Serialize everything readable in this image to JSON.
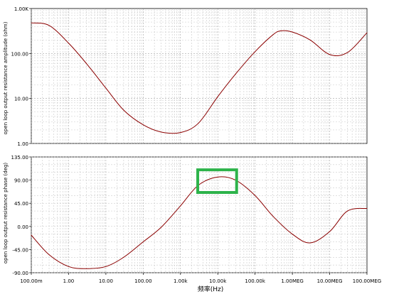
{
  "chart_data": [
    {
      "type": "line",
      "x_scale": "log",
      "y_scale": "log",
      "xlim": [
        0.1,
        100000000
      ],
      "ylim": [
        1,
        1000
      ],
      "y_ticks": [
        1,
        10,
        100,
        1000
      ],
      "y_tick_labels": [
        "1.00",
        "10.00",
        "100.00",
        "1.00K"
      ],
      "ylabel": "open loop output resistance amplitude (ohm)",
      "grid": true,
      "series": [
        {
          "color": "#8b0000",
          "x": [
            0.1,
            0.3,
            1,
            3,
            10,
            30,
            100,
            300,
            1000,
            3000,
            10000,
            30000,
            100000,
            300000,
            500000,
            1000000,
            3000000,
            10000000,
            30000000,
            100000000
          ],
          "y": [
            480,
            420,
            170,
            60,
            17,
            5.5,
            2.6,
            1.8,
            1.75,
            2.8,
            11,
            35,
            110,
            260,
            320,
            300,
            200,
            95,
            105,
            290
          ]
        }
      ]
    },
    {
      "type": "line",
      "x_scale": "log",
      "xlim": [
        0.1,
        100000000
      ],
      "ylim": [
        -90,
        135
      ],
      "y_ticks": [
        -90,
        -45,
        0,
        45,
        90,
        135
      ],
      "y_tick_labels": [
        "-90.00",
        "-45.00",
        "0.00",
        "45.00",
        "90.00",
        "135.00"
      ],
      "ylabel": "open loop output resistance phase (deg)",
      "x_ticks": [
        0.1,
        1,
        10,
        100,
        1000,
        10000,
        100000,
        1000000,
        10000000,
        100000000
      ],
      "x_tick_labels": [
        "100.00m",
        "1.00",
        "10.00",
        "100.00",
        "1.00k",
        "10.00k",
        "100.00k",
        "1.00MEG",
        "10.00MEG",
        "100.00MEG"
      ],
      "xlabel": "频率(Hz)",
      "grid": true,
      "series": [
        {
          "color": "#8b0000",
          "x": [
            0.1,
            0.3,
            1,
            3,
            10,
            30,
            100,
            300,
            1000,
            3000,
            10000,
            30000,
            100000,
            300000,
            1000000,
            3000000,
            10000000,
            30000000,
            100000000
          ],
          "y": [
            -17,
            -55,
            -78,
            -82,
            -78,
            -60,
            -30,
            -2,
            40,
            80,
            96,
            90,
            60,
            20,
            -15,
            -32,
            -10,
            30,
            35
          ]
        }
      ]
    }
  ],
  "annotations": {
    "highlight_color": "#2db34a",
    "highlight_x_range": [
      2900,
      32000
    ],
    "highlight_y_range": [
      66,
      110
    ]
  }
}
